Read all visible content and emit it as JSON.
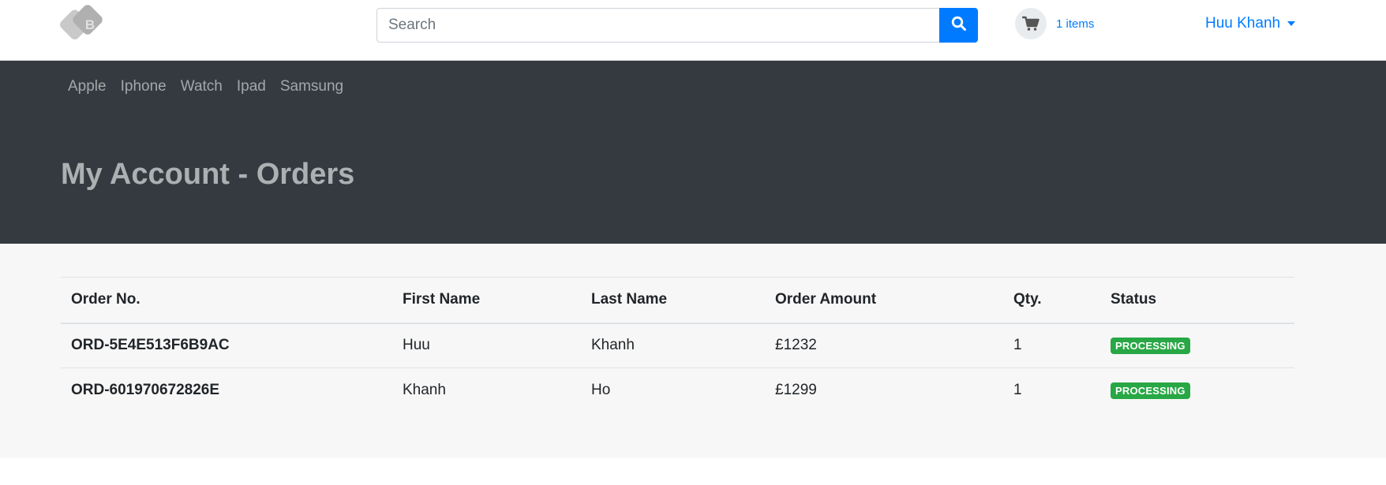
{
  "header": {
    "search": {
      "placeholder": "Search",
      "value": ""
    },
    "cart": {
      "count_label": "1 items"
    },
    "user": {
      "name": "Huu Khanh"
    },
    "colors": {
      "accent": "#007bff",
      "hero_bg": "#343a40",
      "success": "#28a745"
    }
  },
  "nav": {
    "categories": [
      "Apple",
      "Iphone",
      "Watch",
      "Ipad",
      "Samsung"
    ]
  },
  "page": {
    "title": "My Account - Orders"
  },
  "orders": {
    "columns": [
      "Order No.",
      "First Name",
      "Last Name",
      "Order Amount",
      "Qty.",
      "Status"
    ],
    "rows": [
      {
        "order_no": "ORD-5E4E513F6B9AC",
        "first_name": "Huu",
        "last_name": "Khanh",
        "amount": "£1232",
        "qty": "1",
        "status": "PROCESSING"
      },
      {
        "order_no": "ORD-601970672826E",
        "first_name": "Khanh",
        "last_name": "Ho",
        "amount": "£1299",
        "qty": "1",
        "status": "PROCESSING"
      }
    ]
  },
  "icons": {
    "logo": "brand-logo-icon",
    "search": "search-icon",
    "cart": "shopping-cart-icon",
    "caret": "caret-down-icon"
  }
}
